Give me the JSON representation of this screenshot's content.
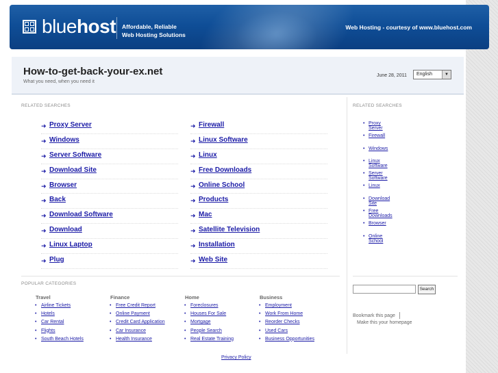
{
  "banner": {
    "logo_prefix": "blue",
    "logo_suffix": "host",
    "tagline_line1": "Affordable, Reliable",
    "tagline_line2": "Web Hosting Solutions",
    "courtesy": "Web Hosting - courtesy of www.bluehost.com"
  },
  "header": {
    "title": "How-to-get-back-your-ex.net",
    "subtitle": "What you need, when you need it",
    "date": "June 28, 2011",
    "language": "English"
  },
  "related": {
    "heading": "RELATED SEARCHES",
    "left_column": [
      "Proxy Server",
      "Windows",
      "Server Software",
      "Download Site",
      "Browser",
      "Back",
      "Download Software",
      "Download",
      "Linux Laptop",
      "Plug"
    ],
    "right_column": [
      "Firewall",
      "Linux Software",
      "Linux",
      "Free Downloads",
      "Online School",
      "Products",
      "Mac",
      "Satellite Television",
      "Installation",
      "Web Site"
    ]
  },
  "sidebar": {
    "heading": "RELATED SEARCHES",
    "items": [
      "Proxy Server",
      "Firewall",
      "Windows",
      "Linux Software",
      "Server Software",
      "Linux",
      "Download Site",
      "Free Downloads",
      "Browser",
      "Online School"
    ],
    "search_button": "Search",
    "bookmark": "Bookmark this page",
    "homepage": "Make this your homepage"
  },
  "popular": {
    "heading": "POPULAR CATEGORIES",
    "categories": [
      {
        "title": "Travel",
        "items": [
          "Airline Tickets",
          "Hotels",
          "Car Rental",
          "Flights",
          "South Beach Hotels"
        ]
      },
      {
        "title": "Finance",
        "items": [
          "Free Credit Report",
          "Online Payment",
          "Credit Card Application",
          "Car Insurance",
          "Health Insurance"
        ]
      },
      {
        "title": "Home",
        "items": [
          "Foreclosures",
          "Houses For Sale",
          "Mortgage",
          "People Search",
          "Real Estate Training"
        ]
      },
      {
        "title": "Business",
        "items": [
          "Employment",
          "Work From Home",
          "Reorder Checks",
          "Used Cars",
          "Business Opportunities"
        ]
      }
    ]
  },
  "footer": {
    "privacy": "Privacy Policy"
  }
}
